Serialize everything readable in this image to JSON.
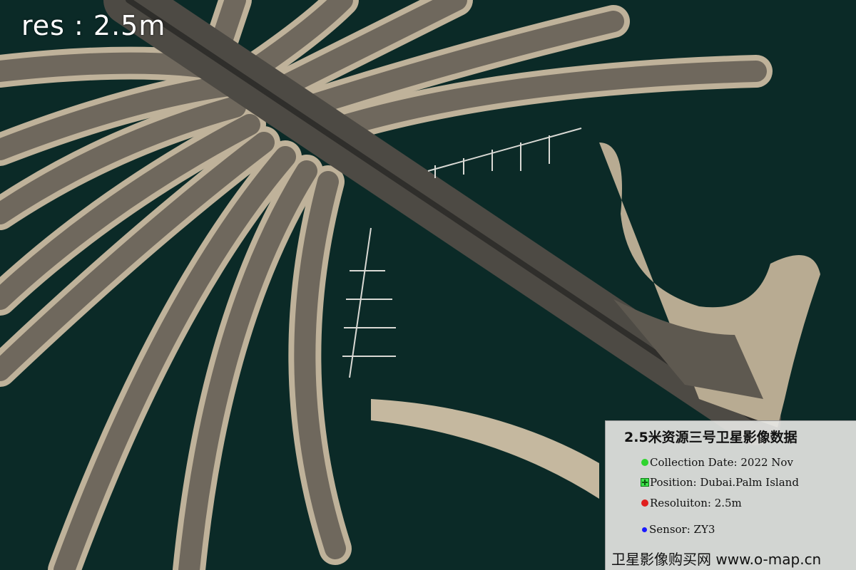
{
  "image": {
    "resolution_label": "res : 2.5m",
    "colors": {
      "sea": "#0b2a27",
      "land": "#9c8f7a",
      "sand": "#c9bca4",
      "buildings": "#5f5a52"
    }
  },
  "info_panel": {
    "title": "2.5米资源三号卫星影像数据",
    "legend": [
      {
        "marker": "green-dot-icon",
        "color": "#2fd42f",
        "text": "Collection Date: 2022 Nov"
      },
      {
        "marker": "position-cross-icon",
        "color": "#3fe24c",
        "text": "Position: Dubai.Palm Island"
      },
      {
        "marker": "red-dot-icon",
        "color": "#e01e1e",
        "text": "Resoluiton: 2.5m"
      },
      {
        "marker": "blue-dot-icon",
        "color": "#1a1aff",
        "text": "Sensor:  ZY3"
      }
    ],
    "footer": "卫星影像购买网 www.o-map.cn"
  }
}
